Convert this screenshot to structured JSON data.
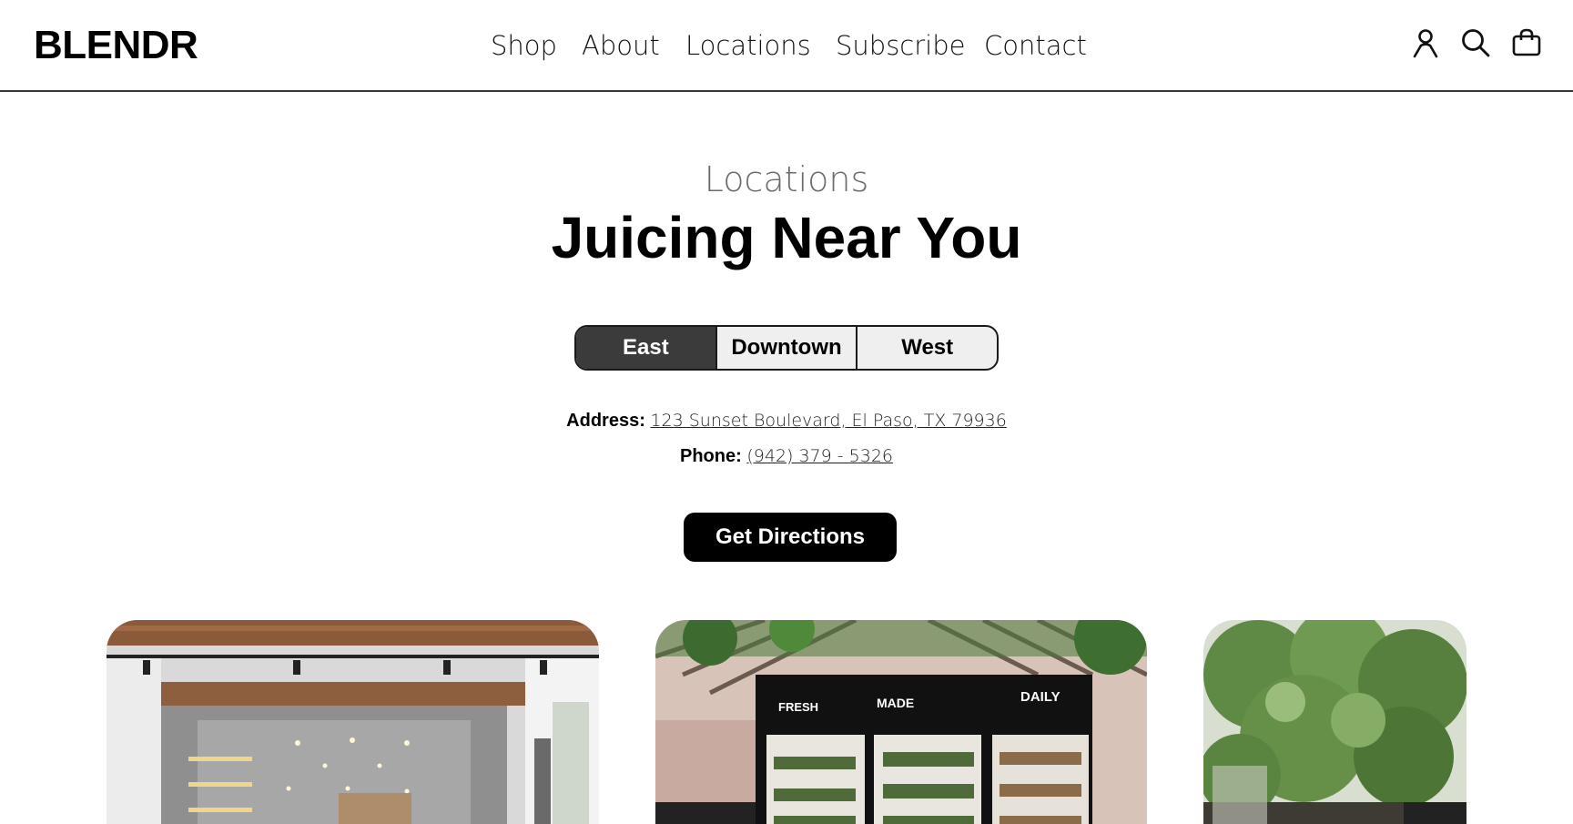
{
  "brand": {
    "logo_text": "BLENDR"
  },
  "nav": {
    "items": [
      {
        "label": "Shop"
      },
      {
        "label": "About"
      },
      {
        "label": "Locations"
      },
      {
        "label": "Subscribe"
      },
      {
        "label": "Contact"
      }
    ]
  },
  "header_icons": [
    "account-icon",
    "search-icon",
    "cart-bag-icon"
  ],
  "hero": {
    "eyebrow": "Locations",
    "title": "Juicing Near You"
  },
  "location_tabs": {
    "items": [
      {
        "label": "East",
        "selected": true
      },
      {
        "label": "Downtown",
        "selected": false
      },
      {
        "label": "West",
        "selected": false
      }
    ]
  },
  "location_info": {
    "address_label": "Address:",
    "address_value": "123 Sunset Boulevard, El Paso, TX 79936",
    "phone_label": "Phone:",
    "phone_value": "(942) 379 - 5326"
  },
  "cta": {
    "label": "Get Directions"
  },
  "gallery": {
    "fridge_signs": [
      "FRESH",
      "MADE",
      "DAILY"
    ]
  },
  "colors": {
    "text": "#000000",
    "muted": "#6b6b6b",
    "tab_active_bg": "#3b3b3b",
    "tab_inactive_bg": "#efefef",
    "button_bg": "#000000"
  }
}
